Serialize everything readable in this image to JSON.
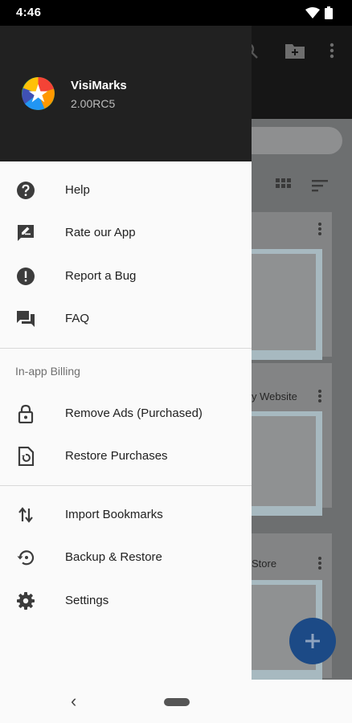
{
  "status_bar": {
    "time": "4:46"
  },
  "drawer": {
    "app_name": "VisiMarks",
    "app_version": "2.00RC5",
    "items_main": [
      {
        "label": "Help",
        "icon": "help-icon"
      },
      {
        "label": "Rate our App",
        "icon": "rate-review-icon"
      },
      {
        "label": "Report a Bug",
        "icon": "report-icon"
      },
      {
        "label": "FAQ",
        "icon": "forum-icon"
      }
    ],
    "billing_header": "In-app Billing",
    "items_billing": [
      {
        "label": "Remove Ads (Purchased)",
        "icon": "lock-icon"
      },
      {
        "label": "Restore Purchases",
        "icon": "restore-page-icon"
      }
    ],
    "items_other": [
      {
        "label": "Import Bookmarks",
        "icon": "import-export-icon"
      },
      {
        "label": "Backup & Restore",
        "icon": "backup-restore-icon"
      },
      {
        "label": "Settings",
        "icon": "settings-icon"
      }
    ]
  },
  "background": {
    "card_titles": [
      "y Website",
      "Store"
    ]
  },
  "nav_bar": {
    "back_glyph": "‹"
  },
  "colors": {
    "drawer_header": "#212121",
    "drawer_bg": "#fafafa",
    "icon": "#3c3c3c",
    "fab": "#1c4a86"
  }
}
